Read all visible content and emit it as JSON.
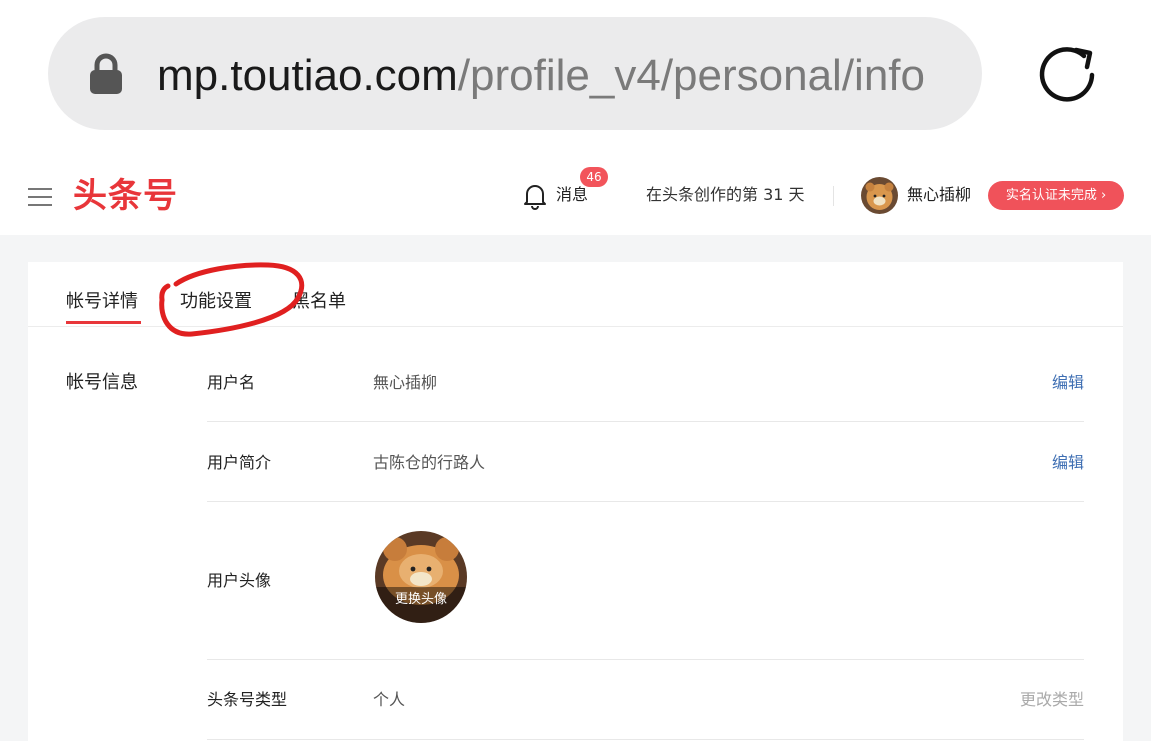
{
  "browser": {
    "url_domain": "mp.toutiao.com",
    "url_path": "/profile_v4/personal/info"
  },
  "header": {
    "brand": "头条号",
    "messages_label": "消息",
    "messages_badge": "46",
    "days_text": "在头条创作的第 31 天",
    "username": "無心插柳",
    "verify_label": "实名认证未完成 ›"
  },
  "tabs": [
    {
      "label": "帐号详情",
      "active": true
    },
    {
      "label": "功能设置",
      "active": false
    },
    {
      "label": "黑名单",
      "active": false
    }
  ],
  "account": {
    "section_label": "帐号信息",
    "rows": [
      {
        "label": "用户名",
        "value": "無心插柳",
        "action": "编辑"
      },
      {
        "label": "用户简介",
        "value": "古陈仓的行路人",
        "action": "编辑"
      },
      {
        "label": "用户头像",
        "avatar_overlay": "更换头像"
      },
      {
        "label": "头条号类型",
        "value": "个人",
        "action": "更改类型"
      }
    ]
  },
  "colors": {
    "brand_red": "#e8363a",
    "link_blue": "#3f6fb3",
    "badge_red": "#f2545b"
  },
  "icons": [
    "lock-icon",
    "reload-icon",
    "menu-icon",
    "bell-icon"
  ]
}
